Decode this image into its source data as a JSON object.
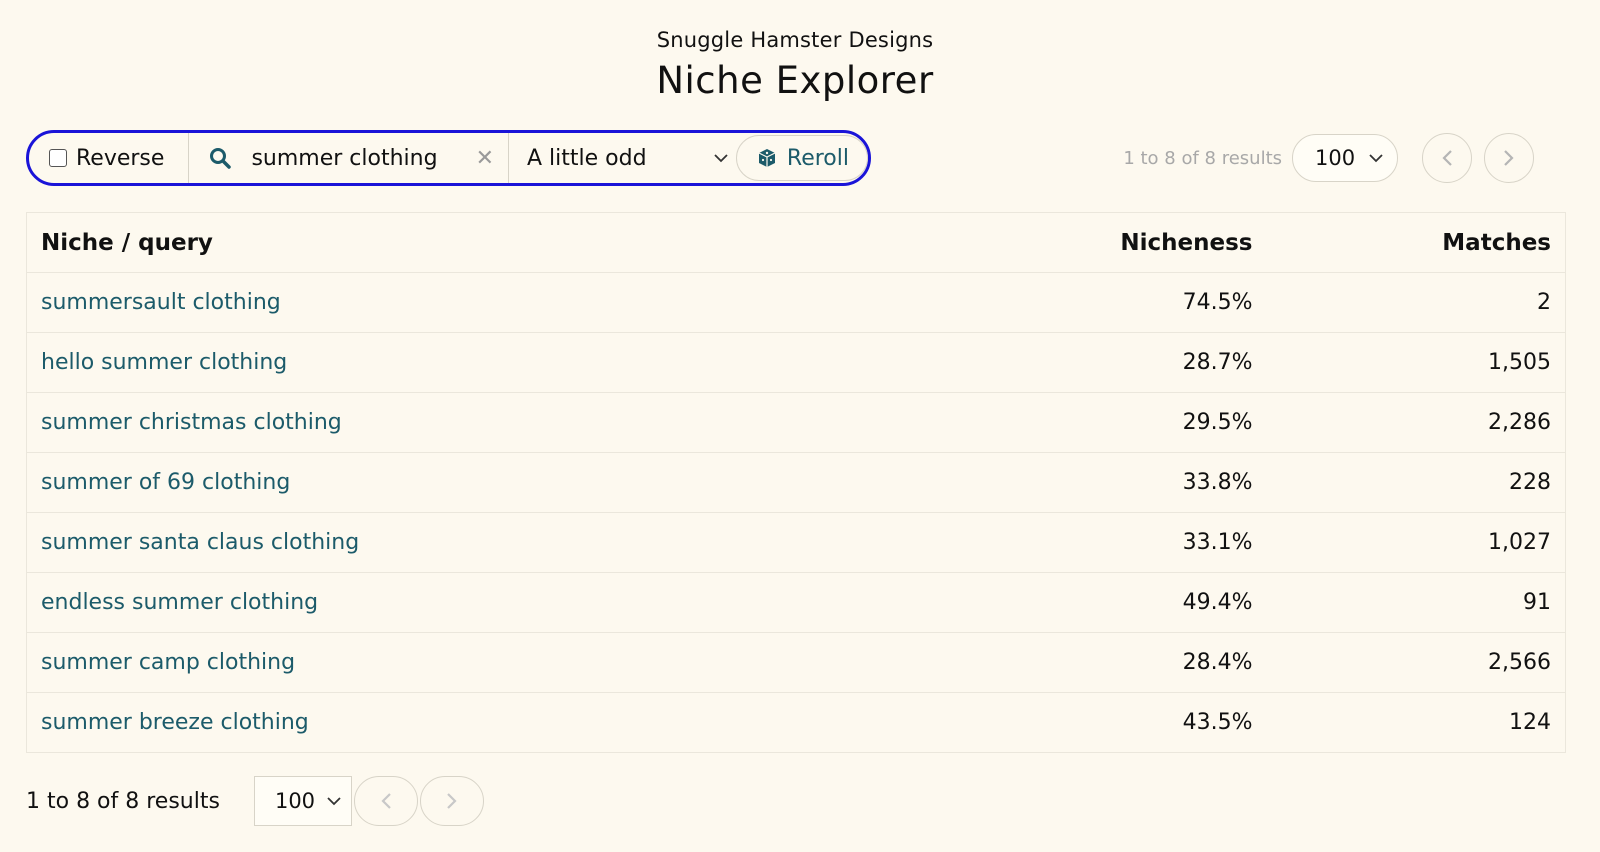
{
  "header": {
    "brand": "Snuggle Hamster Designs",
    "title": "Niche Explorer"
  },
  "toolbar": {
    "reverse_label": "Reverse",
    "search_value": "summer clothing",
    "mode_value": "A little odd",
    "reroll_label": "Reroll",
    "icons": {
      "search": "search-icon",
      "clear": "clear-icon",
      "dropdown": "chevron-down-icon",
      "reroll": "dice-icon"
    },
    "accent_color": "#1a14d8"
  },
  "pager_top": {
    "results_text": "1 to 8 of 8 results",
    "page_size": "100"
  },
  "table": {
    "headers": {
      "niche": "Niche / query",
      "nicheness": "Nicheness",
      "matches": "Matches"
    },
    "rows": [
      {
        "niche": "summersault clothing",
        "nicheness": "74.5%",
        "matches": "2"
      },
      {
        "niche": "hello summer clothing",
        "nicheness": "28.7%",
        "matches": "1,505"
      },
      {
        "niche": "summer christmas clothing",
        "nicheness": "29.5%",
        "matches": "2,286"
      },
      {
        "niche": "summer of 69 clothing",
        "nicheness": "33.8%",
        "matches": "228"
      },
      {
        "niche": "summer santa claus clothing",
        "nicheness": "33.1%",
        "matches": "1,027"
      },
      {
        "niche": "endless summer clothing",
        "nicheness": "49.4%",
        "matches": "91"
      },
      {
        "niche": "summer camp clothing",
        "nicheness": "28.4%",
        "matches": "2,566"
      },
      {
        "niche": "summer breeze clothing",
        "nicheness": "43.5%",
        "matches": "124"
      }
    ],
    "link_color": "#1c5b6a"
  },
  "pager_bottom": {
    "results_text": "1 to 8 of 8 results",
    "page_size": "100"
  }
}
